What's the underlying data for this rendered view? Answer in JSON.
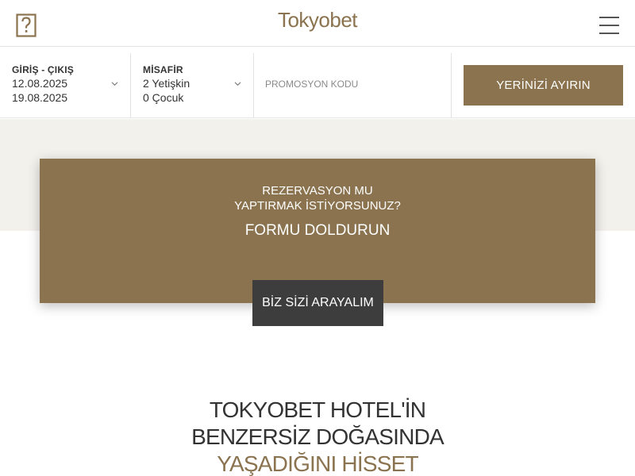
{
  "header": {
    "brand": "Tokyobet",
    "logo_icon": "question-box-icon",
    "menu_icon": "hamburger-menu-icon"
  },
  "booking": {
    "dates_label": "GİRİŞ - ÇIKIŞ",
    "check_in": "12.08.2025",
    "check_out": "19.08.2025",
    "guests_label": "MİSAFİR",
    "adults": "2 Yetişkin",
    "children": "0 Çocuk",
    "promo_placeholder": "PROMOSYON KODU",
    "promo_value": "",
    "reserve_label": "YERİNİZİ AYIRIN"
  },
  "callout": {
    "question_line1": "REZERVASYON MU",
    "question_line2": "YAPTIRMAK İSTİYORSUNUZ?",
    "cta_text": "FORMU DOLDURUN",
    "call_button": "BİZ SİZİ ARAYALIM"
  },
  "headline": {
    "line1": "TOKYOBET HOTEL'İN",
    "line2": "BENZERSİZ DOĞASINDA",
    "line3": "YAŞADIĞINI HİSSET"
  },
  "colors": {
    "accent": "#8a734e",
    "dark_button": "#3d3d3d",
    "band": "#f3f1ec"
  }
}
